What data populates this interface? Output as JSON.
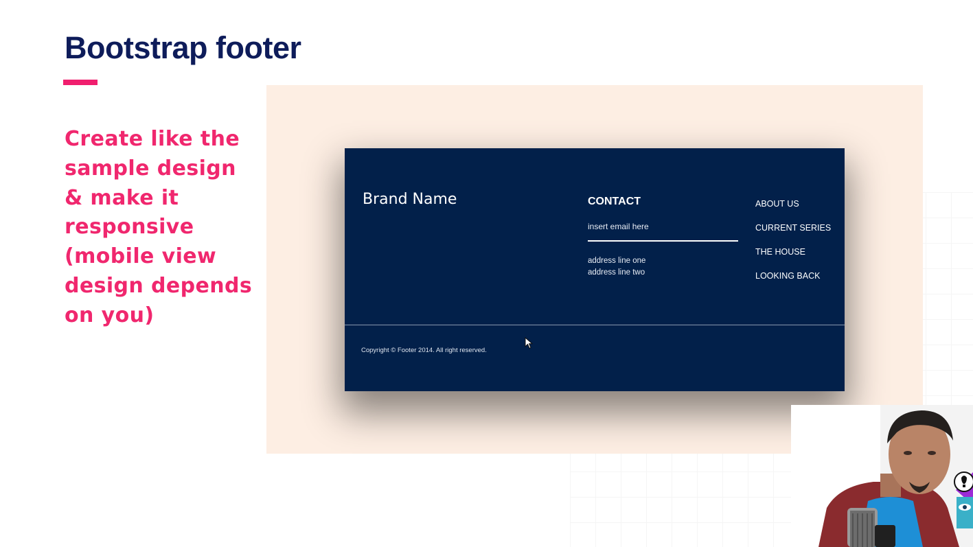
{
  "slide": {
    "title": "Bootstrap footer",
    "task": "Create like the\nsample design\n& make it\nresponsive\n(mobile view\ndesign depends\non you)"
  },
  "footer_mock": {
    "brand_name": "Brand Name",
    "contact_title": "CONTACT",
    "email_placeholder": "insert email here",
    "address_line_one": "address line one",
    "address_line_two": "address line two",
    "links": [
      "ABOUT US",
      "CURRENT SERIES",
      "THE HOUSE",
      "LOOKING BACK"
    ],
    "copyright": "Copyright © Footer 2014. All right reserved."
  },
  "colors": {
    "title": "#0e1c5a",
    "accent": "#f01e6e",
    "task_text": "#f0276e",
    "panel_bg": "#fdeee3",
    "footer_bg": "#02204a"
  },
  "icons": {
    "cursor": "mouse-cursor-icon",
    "webcam": "presenter-webcam",
    "badge": "lightbulb-eye-badge"
  }
}
